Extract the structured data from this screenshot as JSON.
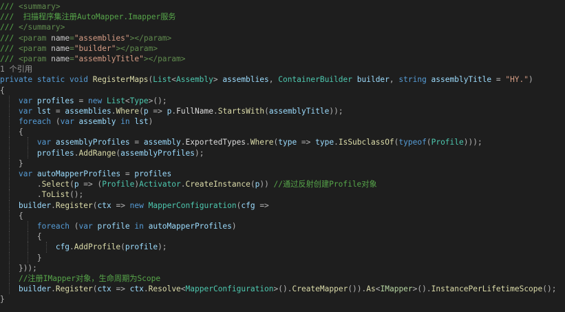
{
  "editor": {
    "lines": [
      {
        "indent": 0,
        "guides": [],
        "tokens": [
          {
            "c": "t-doc",
            "t": "/// "
          },
          {
            "c": "t-tag",
            "t": "<summary>"
          }
        ]
      },
      {
        "indent": 0,
        "guides": [],
        "tokens": [
          {
            "c": "t-doc",
            "t": "///  扫描程序集注册AutoMapper.Imapper服务"
          }
        ]
      },
      {
        "indent": 0,
        "guides": [],
        "tokens": [
          {
            "c": "t-doc",
            "t": "/// "
          },
          {
            "c": "t-tag",
            "t": "</summary>"
          }
        ]
      },
      {
        "indent": 0,
        "guides": [],
        "tokens": [
          {
            "c": "t-doc",
            "t": "/// "
          },
          {
            "c": "t-tag",
            "t": "<param "
          },
          {
            "c": "t-attr",
            "t": "name"
          },
          {
            "c": "t-tag",
            "t": "="
          },
          {
            "c": "t-str",
            "t": "\"assemblies\""
          },
          {
            "c": "t-tag",
            "t": "></param>"
          }
        ]
      },
      {
        "indent": 0,
        "guides": [],
        "tokens": [
          {
            "c": "t-doc",
            "t": "/// "
          },
          {
            "c": "t-tag",
            "t": "<param "
          },
          {
            "c": "t-attr",
            "t": "name"
          },
          {
            "c": "t-tag",
            "t": "="
          },
          {
            "c": "t-str",
            "t": "\"builder\""
          },
          {
            "c": "t-tag",
            "t": "></param>"
          }
        ]
      },
      {
        "indent": 0,
        "guides": [],
        "tokens": [
          {
            "c": "t-doc",
            "t": "/// "
          },
          {
            "c": "t-tag",
            "t": "<param "
          },
          {
            "c": "t-attr",
            "t": "name"
          },
          {
            "c": "t-tag",
            "t": "="
          },
          {
            "c": "t-str",
            "t": "\"assemblyTitle\""
          },
          {
            "c": "t-tag",
            "t": "></param>"
          }
        ]
      },
      {
        "indent": 0,
        "guides": [],
        "tokens": [
          {
            "c": "t-lens",
            "t": "1 个引用"
          }
        ]
      },
      {
        "indent": 0,
        "guides": [],
        "tokens": [
          {
            "c": "t-kw",
            "t": "private static void "
          },
          {
            "c": "t-meth",
            "t": "RegisterMaps"
          },
          {
            "c": "t-pun",
            "t": "("
          },
          {
            "c": "t-type",
            "t": "List"
          },
          {
            "c": "t-pun",
            "t": "<"
          },
          {
            "c": "t-type",
            "t": "Assembly"
          },
          {
            "c": "t-pun",
            "t": "> "
          },
          {
            "c": "t-var",
            "t": "assemblies"
          },
          {
            "c": "t-pun",
            "t": ", "
          },
          {
            "c": "t-type",
            "t": "ContainerBuilder"
          },
          {
            "c": "t-plain",
            "t": " "
          },
          {
            "c": "t-var",
            "t": "builder"
          },
          {
            "c": "t-pun",
            "t": ", "
          },
          {
            "c": "t-kw",
            "t": "string "
          },
          {
            "c": "t-var",
            "t": "assemblyTitle"
          },
          {
            "c": "t-pun",
            "t": " = "
          },
          {
            "c": "t-lit",
            "t": "\"HY.\""
          },
          {
            "c": "t-pun",
            "t": ")"
          }
        ]
      },
      {
        "indent": 0,
        "guides": [],
        "tokens": [
          {
            "c": "t-pun",
            "t": "{"
          }
        ]
      },
      {
        "indent": 4,
        "guides": [
          1
        ],
        "tokens": [
          {
            "c": "t-kw",
            "t": "var "
          },
          {
            "c": "t-var",
            "t": "profiles"
          },
          {
            "c": "t-pun",
            "t": " = "
          },
          {
            "c": "t-kw",
            "t": "new "
          },
          {
            "c": "t-type",
            "t": "List"
          },
          {
            "c": "t-pun",
            "t": "<"
          },
          {
            "c": "t-type",
            "t": "Type"
          },
          {
            "c": "t-pun",
            "t": ">();"
          }
        ]
      },
      {
        "indent": 4,
        "guides": [
          1
        ],
        "tokens": [
          {
            "c": "t-kw",
            "t": "var "
          },
          {
            "c": "t-var",
            "t": "lst"
          },
          {
            "c": "t-pun",
            "t": " = "
          },
          {
            "c": "t-var",
            "t": "assemblies"
          },
          {
            "c": "t-pun",
            "t": "."
          },
          {
            "c": "t-meth",
            "t": "Where"
          },
          {
            "c": "t-pun",
            "t": "("
          },
          {
            "c": "t-var",
            "t": "p"
          },
          {
            "c": "t-pun",
            "t": " => "
          },
          {
            "c": "t-var",
            "t": "p"
          },
          {
            "c": "t-pun",
            "t": "."
          },
          {
            "c": "t-plain",
            "t": "FullName"
          },
          {
            "c": "t-pun",
            "t": "."
          },
          {
            "c": "t-meth",
            "t": "StartsWith"
          },
          {
            "c": "t-pun",
            "t": "("
          },
          {
            "c": "t-var",
            "t": "assemblyTitle"
          },
          {
            "c": "t-pun",
            "t": "));"
          }
        ]
      },
      {
        "indent": 4,
        "guides": [
          1
        ],
        "tokens": [
          {
            "c": "t-kw",
            "t": "foreach "
          },
          {
            "c": "t-pun",
            "t": "("
          },
          {
            "c": "t-kw",
            "t": "var "
          },
          {
            "c": "t-var",
            "t": "assembly"
          },
          {
            "c": "t-kw",
            "t": " in "
          },
          {
            "c": "t-var",
            "t": "lst"
          },
          {
            "c": "t-pun",
            "t": ")"
          }
        ]
      },
      {
        "indent": 4,
        "guides": [
          1
        ],
        "tokens": [
          {
            "c": "t-pun",
            "t": "{"
          }
        ]
      },
      {
        "indent": 8,
        "guides": [
          1,
          5
        ],
        "tokens": [
          {
            "c": "t-kw",
            "t": "var "
          },
          {
            "c": "t-var",
            "t": "assemblyProfiles"
          },
          {
            "c": "t-pun",
            "t": " = "
          },
          {
            "c": "t-var",
            "t": "assembly"
          },
          {
            "c": "t-pun",
            "t": "."
          },
          {
            "c": "t-plain",
            "t": "ExportedTypes"
          },
          {
            "c": "t-pun",
            "t": "."
          },
          {
            "c": "t-meth",
            "t": "Where"
          },
          {
            "c": "t-pun",
            "t": "("
          },
          {
            "c": "t-var",
            "t": "type"
          },
          {
            "c": "t-pun",
            "t": " => "
          },
          {
            "c": "t-var",
            "t": "type"
          },
          {
            "c": "t-pun",
            "t": "."
          },
          {
            "c": "t-meth",
            "t": "IsSubclassOf"
          },
          {
            "c": "t-pun",
            "t": "("
          },
          {
            "c": "t-kw",
            "t": "typeof"
          },
          {
            "c": "t-pun",
            "t": "("
          },
          {
            "c": "t-type",
            "t": "Profile"
          },
          {
            "c": "t-pun",
            "t": ")));"
          }
        ]
      },
      {
        "indent": 8,
        "guides": [
          1,
          5
        ],
        "tokens": [
          {
            "c": "t-var",
            "t": "profiles"
          },
          {
            "c": "t-pun",
            "t": "."
          },
          {
            "c": "t-meth",
            "t": "AddRange"
          },
          {
            "c": "t-pun",
            "t": "("
          },
          {
            "c": "t-var",
            "t": "assemblyProfiles"
          },
          {
            "c": "t-pun",
            "t": ");"
          }
        ]
      },
      {
        "indent": 4,
        "guides": [
          1
        ],
        "tokens": [
          {
            "c": "t-pun",
            "t": "}"
          }
        ]
      },
      {
        "indent": 4,
        "guides": [
          1
        ],
        "tokens": [
          {
            "c": "t-kw",
            "t": "var "
          },
          {
            "c": "t-var",
            "t": "autoMapperProfiles"
          },
          {
            "c": "t-pun",
            "t": " = "
          },
          {
            "c": "t-var",
            "t": "profiles"
          }
        ]
      },
      {
        "indent": 8,
        "guides": [
          1
        ],
        "tokens": [
          {
            "c": "t-pun",
            "t": "."
          },
          {
            "c": "t-meth",
            "t": "Select"
          },
          {
            "c": "t-pun",
            "t": "("
          },
          {
            "c": "t-var",
            "t": "p"
          },
          {
            "c": "t-pun",
            "t": " => ("
          },
          {
            "c": "t-type",
            "t": "Profile"
          },
          {
            "c": "t-pun",
            "t": ")"
          },
          {
            "c": "t-type",
            "t": "Activator"
          },
          {
            "c": "t-pun",
            "t": "."
          },
          {
            "c": "t-meth",
            "t": "CreateInstance"
          },
          {
            "c": "t-pun",
            "t": "("
          },
          {
            "c": "t-var",
            "t": "p"
          },
          {
            "c": "t-pun",
            "t": ")) "
          },
          {
            "c": "t-com",
            "t": "//通过反射创建Profile对象"
          }
        ]
      },
      {
        "indent": 8,
        "guides": [
          1
        ],
        "tokens": [
          {
            "c": "t-pun",
            "t": "."
          },
          {
            "c": "t-meth",
            "t": "ToList"
          },
          {
            "c": "t-pun",
            "t": "();"
          }
        ]
      },
      {
        "indent": 4,
        "guides": [
          1
        ],
        "tokens": [
          {
            "c": "t-var",
            "t": "builder"
          },
          {
            "c": "t-pun",
            "t": "."
          },
          {
            "c": "t-meth",
            "t": "Register"
          },
          {
            "c": "t-pun",
            "t": "("
          },
          {
            "c": "t-var",
            "t": "ctx"
          },
          {
            "c": "t-pun",
            "t": " => "
          },
          {
            "c": "t-kw",
            "t": "new "
          },
          {
            "c": "t-type",
            "t": "MapperConfiguration"
          },
          {
            "c": "t-pun",
            "t": "("
          },
          {
            "c": "t-var",
            "t": "cfg"
          },
          {
            "c": "t-pun",
            "t": " =>"
          }
        ]
      },
      {
        "indent": 4,
        "guides": [
          1
        ],
        "tokens": [
          {
            "c": "t-pun",
            "t": "{"
          }
        ]
      },
      {
        "indent": 8,
        "guides": [
          1,
          5
        ],
        "tokens": [
          {
            "c": "t-kw",
            "t": "foreach "
          },
          {
            "c": "t-pun",
            "t": "("
          },
          {
            "c": "t-kw",
            "t": "var "
          },
          {
            "c": "t-var",
            "t": "profile"
          },
          {
            "c": "t-kw",
            "t": " in "
          },
          {
            "c": "t-var",
            "t": "autoMapperProfiles"
          },
          {
            "c": "t-pun",
            "t": ")"
          }
        ]
      },
      {
        "indent": 8,
        "guides": [
          1,
          5
        ],
        "tokens": [
          {
            "c": "t-pun",
            "t": "{"
          }
        ]
      },
      {
        "indent": 12,
        "guides": [
          1,
          5,
          9
        ],
        "tokens": [
          {
            "c": "t-var",
            "t": "cfg"
          },
          {
            "c": "t-pun",
            "t": "."
          },
          {
            "c": "t-meth",
            "t": "AddProfile"
          },
          {
            "c": "t-pun",
            "t": "("
          },
          {
            "c": "t-var",
            "t": "profile"
          },
          {
            "c": "t-pun",
            "t": ");"
          }
        ]
      },
      {
        "indent": 8,
        "guides": [
          1,
          5
        ],
        "tokens": [
          {
            "c": "t-pun",
            "t": "}"
          }
        ]
      },
      {
        "indent": 4,
        "guides": [
          1
        ],
        "tokens": [
          {
            "c": "t-pun",
            "t": "}));"
          }
        ]
      },
      {
        "indent": 4,
        "guides": [
          1
        ],
        "tokens": [
          {
            "c": "t-com",
            "t": "//注册IMapper对象，生命周期为Scope"
          }
        ]
      },
      {
        "indent": 4,
        "guides": [
          1
        ],
        "tokens": [
          {
            "c": "t-var",
            "t": "builder"
          },
          {
            "c": "t-pun",
            "t": "."
          },
          {
            "c": "t-meth",
            "t": "Register"
          },
          {
            "c": "t-pun",
            "t": "("
          },
          {
            "c": "t-var",
            "t": "ctx"
          },
          {
            "c": "t-pun",
            "t": " => "
          },
          {
            "c": "t-var",
            "t": "ctx"
          },
          {
            "c": "t-pun",
            "t": "."
          },
          {
            "c": "t-meth",
            "t": "Resolve"
          },
          {
            "c": "t-pun",
            "t": "<"
          },
          {
            "c": "t-type",
            "t": "MapperConfiguration"
          },
          {
            "c": "t-pun",
            "t": ">()."
          },
          {
            "c": "t-meth",
            "t": "CreateMapper"
          },
          {
            "c": "t-pun",
            "t": "())."
          },
          {
            "c": "t-meth",
            "t": "As"
          },
          {
            "c": "t-pun",
            "t": "<"
          },
          {
            "c": "t-iface",
            "t": "IMapper"
          },
          {
            "c": "t-pun",
            "t": ">()."
          },
          {
            "c": "t-meth",
            "t": "InstancePerLifetimeScope"
          },
          {
            "c": "t-pun",
            "t": "();"
          }
        ]
      },
      {
        "indent": 0,
        "guides": [],
        "tokens": [
          {
            "c": "t-pun",
            "t": "}"
          }
        ]
      }
    ]
  }
}
